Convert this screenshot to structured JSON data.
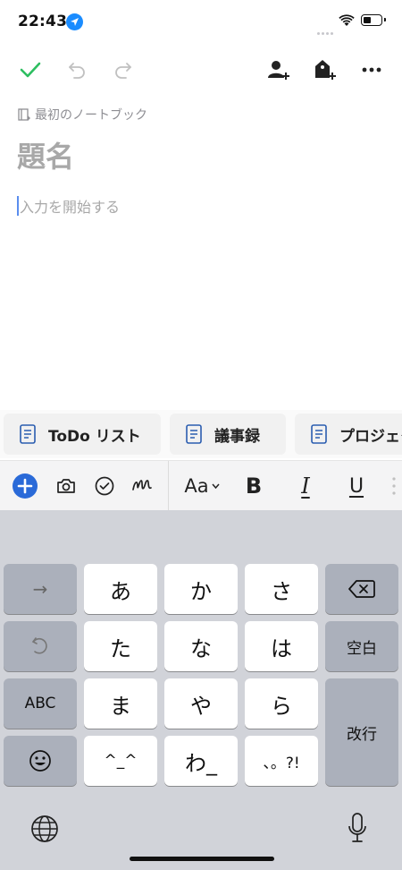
{
  "status_bar": {
    "time": "22:43"
  },
  "toolbar": {
    "icons": [
      "check-icon",
      "undo-icon",
      "redo-icon",
      "add-person-icon",
      "add-tag-icon",
      "more-icon"
    ],
    "accent_color": "#2dbe60"
  },
  "note": {
    "notebook": "最初のノートブック",
    "title_placeholder": "題名",
    "body_placeholder": "入力を開始する"
  },
  "templates": [
    {
      "label": "ToDo リスト"
    },
    {
      "label": "議事録"
    },
    {
      "label": "プロジェクト"
    }
  ],
  "format_bar": {
    "font_label": "Aa",
    "bold_label": "B",
    "italic_label": "I",
    "underline_label": "U"
  },
  "keyboard": {
    "row1": {
      "left": "→",
      "keys": [
        "あ",
        "か",
        "さ"
      ],
      "right_icon": "backspace-icon"
    },
    "row2": {
      "left_icon": "undo-icon",
      "keys": [
        "た",
        "な",
        "は"
      ],
      "right": "空白"
    },
    "row3": {
      "left": "ABC",
      "keys": [
        "ま",
        "や",
        "ら"
      ],
      "right": "改行"
    },
    "row4": {
      "left_icon": "emoji-icon",
      "keys": [
        "^_^",
        "わ_",
        "、。?!"
      ]
    }
  }
}
